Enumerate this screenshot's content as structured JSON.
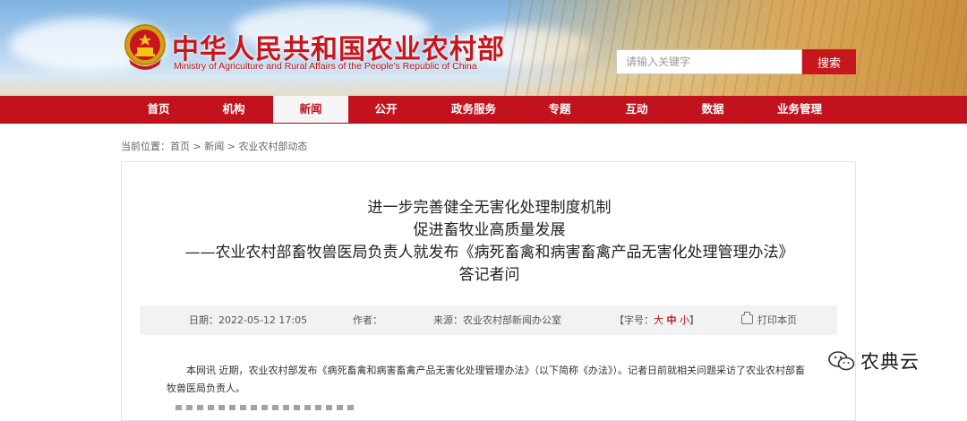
{
  "header": {
    "title": "中华人民共和国农业农村部",
    "subtitle": "Ministry of Agriculture and Rural Affairs of the People's Republic of China",
    "search_placeholder": "请输入关键字",
    "search_button": "搜索"
  },
  "nav": {
    "items": [
      {
        "label": "首页"
      },
      {
        "label": "机构"
      },
      {
        "label": "新闻",
        "active": true
      },
      {
        "label": "公开"
      },
      {
        "label": "政务服务"
      },
      {
        "label": "专题"
      },
      {
        "label": "互动"
      },
      {
        "label": "数据"
      },
      {
        "label": "业务管理"
      }
    ]
  },
  "breadcrumb": {
    "prefix": "当前位置：",
    "items": [
      "首页",
      "新闻",
      "农业农村部动态"
    ],
    "separator": " > "
  },
  "article": {
    "title_lines": [
      "进一步完善健全无害化处理制度机制",
      "促进畜牧业高质量发展",
      "——农业农村部畜牧兽医局负责人就发布《病死畜禽和病害畜禽产品无害化处理管理办法》",
      "答记者问"
    ],
    "meta": {
      "date_label": "日期：",
      "date": "2022-05-12 17:05",
      "author_label": "作者：",
      "author": "",
      "source_label": "来源：",
      "source": "农业农村部新闻办公室",
      "font_size_label": "【字号：",
      "font_big": "大",
      "font_mid": "中",
      "font_small": "小",
      "font_close": "】",
      "print": "打印本页"
    },
    "body": "本网讯 近期，农业农村部发布《病死畜禽和病害畜禽产品无害化处理管理办法》（以下简称《办法》）。记者日前就相关问题采访了农业农村部畜牧兽医局负责人。"
  },
  "watermark": {
    "text": "农典云",
    "icon": "wechat-icon"
  },
  "colors": {
    "brand_red": "#c1121d",
    "title_red": "#c8161d"
  }
}
